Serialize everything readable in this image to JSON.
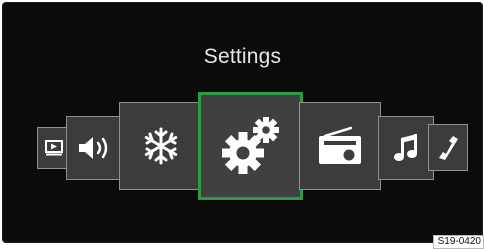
{
  "screen": {
    "title": "Settings",
    "selected_color": "#2f9a45",
    "tiles": [
      {
        "id": "video",
        "icon": "video-icon"
      },
      {
        "id": "audio",
        "icon": "volume-icon"
      },
      {
        "id": "climate",
        "icon": "snowflake-icon"
      },
      {
        "id": "settings",
        "icon": "gears-icon",
        "selected": true
      },
      {
        "id": "radio",
        "icon": "radio-icon"
      },
      {
        "id": "media",
        "icon": "music-note-icon"
      },
      {
        "id": "phone",
        "icon": "phone-icon"
      }
    ]
  },
  "figure_code": "S19-0420"
}
